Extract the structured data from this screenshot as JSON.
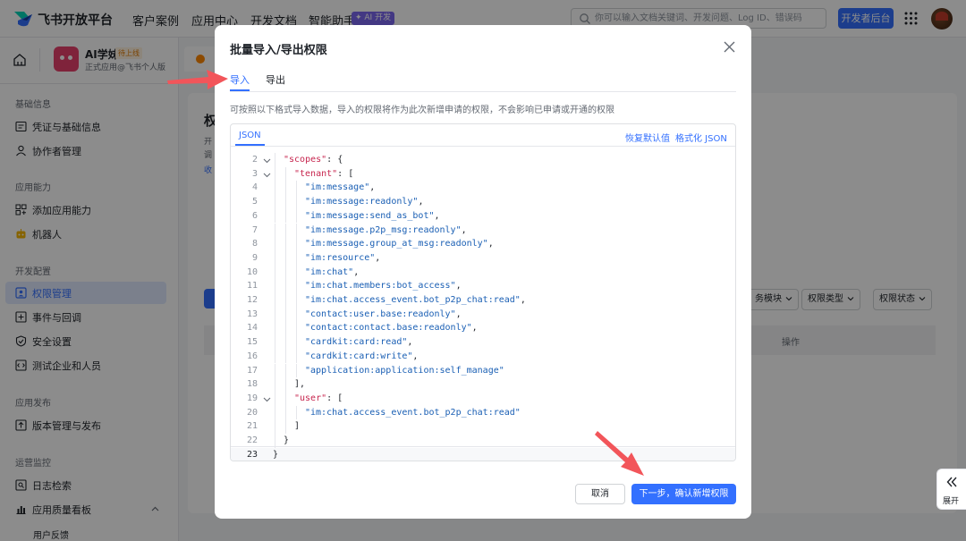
{
  "topnav": {
    "brand": "飞书开放平台",
    "items": [
      "客户案例",
      "应用中心",
      "开发文档",
      "智能助手"
    ],
    "ai_badge": "✦ AI 开发",
    "search_placeholder": "你可以输入文档关键词、开发问题、Log ID、错误码",
    "dev_console": "开发者后台"
  },
  "sidebar": {
    "app_name": "AI学妹",
    "app_tag": "待上线",
    "app_sub": "正式应用@飞书个人版",
    "sections": [
      {
        "title": "基础信息",
        "items": [
          {
            "label": "凭证与基础信息",
            "icon": "credential-icon"
          },
          {
            "label": "协作者管理",
            "icon": "user-icon"
          }
        ]
      },
      {
        "title": "应用能力",
        "items": [
          {
            "label": "添加应用能力",
            "icon": "grid-add-icon"
          },
          {
            "label": "机器人",
            "icon": "robot-icon"
          }
        ]
      },
      {
        "title": "开发配置",
        "items": [
          {
            "label": "权限管理",
            "icon": "permission-icon",
            "active": true
          },
          {
            "label": "事件与回调",
            "icon": "event-icon"
          },
          {
            "label": "安全设置",
            "icon": "shield-icon"
          },
          {
            "label": "测试企业和人员",
            "icon": "test-icon"
          }
        ]
      },
      {
        "title": "应用发布",
        "items": [
          {
            "label": "版本管理与发布",
            "icon": "upload-icon"
          }
        ]
      },
      {
        "title": "运营监控",
        "items": [
          {
            "label": "日志检索",
            "icon": "log-icon"
          },
          {
            "label": "应用质量看板",
            "icon": "chart-icon"
          }
        ]
      }
    ],
    "sub_item": "用户反馈"
  },
  "background": {
    "title_fragment": "权",
    "lines": [
      "开",
      "调",
      "收"
    ],
    "table_header_action": "操作",
    "filters": [
      "务模块",
      "权限类型",
      "权限状态"
    ]
  },
  "modal": {
    "title": "批量导入/导出权限",
    "tabs": [
      "导入",
      "导出"
    ],
    "description": "可按照以下格式导入数据，导入的权限将作为此次新增申请的权限，不会影响已申请或开通的权限",
    "editor_tab": "JSON",
    "restore_default": "恢复默认值",
    "format_json": "格式化 JSON",
    "code_lines": [
      {
        "n": "2",
        "indent": 1,
        "fold": true,
        "html": "<span class=\"key\">\"scopes\"</span>: {"
      },
      {
        "n": "3",
        "indent": 2,
        "fold": true,
        "html": "<span class=\"key\">\"tenant\"</span>: ["
      },
      {
        "n": "4",
        "indent": 3,
        "html": "<span class=\"str\">\"im:message\"</span>,"
      },
      {
        "n": "5",
        "indent": 3,
        "html": "<span class=\"str\">\"im:message:readonly\"</span>,"
      },
      {
        "n": "6",
        "indent": 3,
        "html": "<span class=\"str\">\"im:message:send_as_bot\"</span>,"
      },
      {
        "n": "7",
        "indent": 3,
        "html": "<span class=\"str\">\"im:message.p2p_msg:readonly\"</span>,"
      },
      {
        "n": "8",
        "indent": 3,
        "html": "<span class=\"str\">\"im:message.group_at_msg:readonly\"</span>,"
      },
      {
        "n": "9",
        "indent": 3,
        "html": "<span class=\"str\">\"im:resource\"</span>,"
      },
      {
        "n": "10",
        "indent": 3,
        "html": "<span class=\"str\">\"im:chat\"</span>,"
      },
      {
        "n": "11",
        "indent": 3,
        "html": "<span class=\"str\">\"im:chat.members:bot_access\"</span>,"
      },
      {
        "n": "12",
        "indent": 3,
        "html": "<span class=\"str\">\"im:chat.access_event.bot_p2p_chat:read\"</span>,"
      },
      {
        "n": "13",
        "indent": 3,
        "html": "<span class=\"str\">\"contact:user.base:readonly\"</span>,"
      },
      {
        "n": "14",
        "indent": 3,
        "html": "<span class=\"str\">\"contact:contact.base:readonly\"</span>,"
      },
      {
        "n": "15",
        "indent": 3,
        "html": "<span class=\"str\">\"cardkit:card:read\"</span>,"
      },
      {
        "n": "16",
        "indent": 3,
        "html": "<span class=\"str\">\"cardkit:card:write\"</span>,"
      },
      {
        "n": "17",
        "indent": 3,
        "html": "<span class=\"str\">\"application:application:self_manage\"</span>"
      },
      {
        "n": "18",
        "indent": 2,
        "html": "],"
      },
      {
        "n": "19",
        "indent": 2,
        "fold": true,
        "html": "<span class=\"key\">\"user\"</span>: ["
      },
      {
        "n": "20",
        "indent": 3,
        "html": "<span class=\"str\">\"im:chat.access_event.bot_p2p_chat:read\"</span>"
      },
      {
        "n": "21",
        "indent": 2,
        "html": "]"
      },
      {
        "n": "22",
        "indent": 1,
        "html": "}"
      },
      {
        "n": "23",
        "indent": 0,
        "current": true,
        "html": "}"
      }
    ],
    "cancel": "取消",
    "next": "下一步，确认新增权限"
  },
  "expand": {
    "label": "展开"
  },
  "colors": {
    "primary": "#3370ff",
    "annotation_arrow": "#f2555a"
  }
}
